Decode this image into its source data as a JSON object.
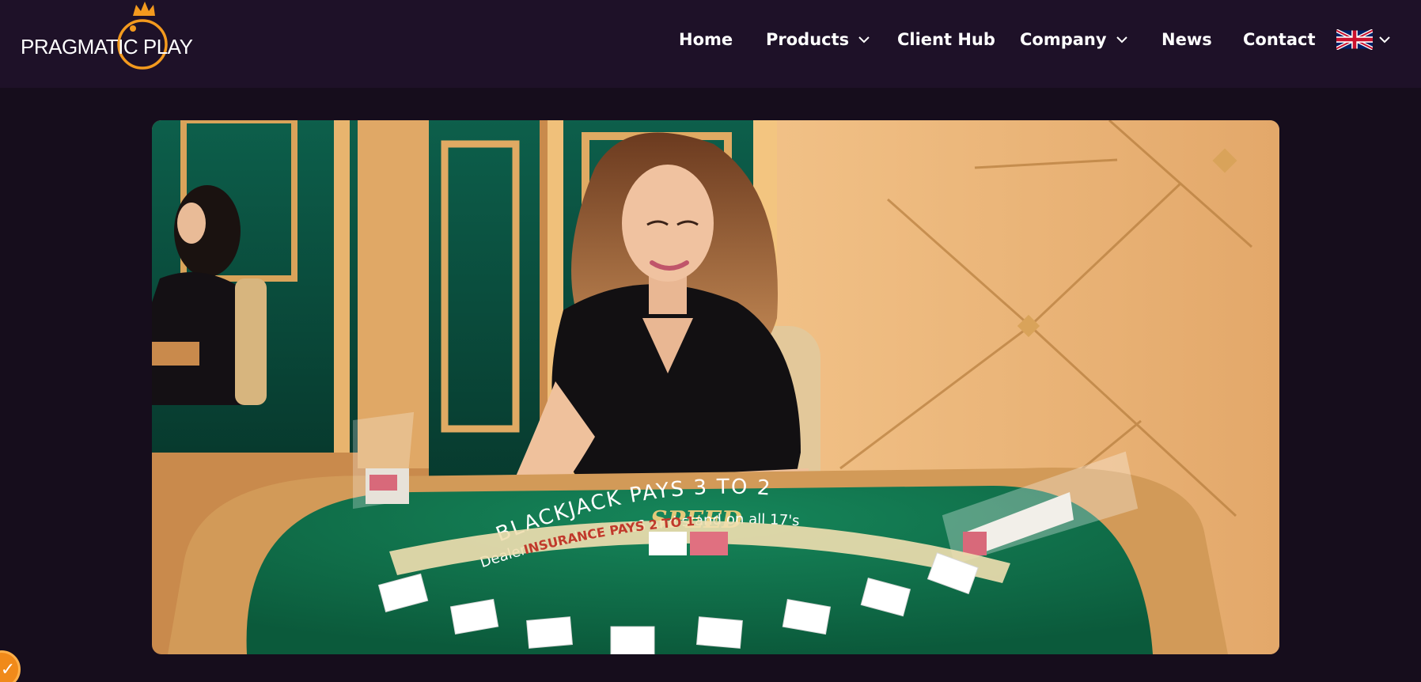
{
  "header": {
    "logo_text": "PRAGMATIC PLAY",
    "nav": [
      {
        "label": "Home",
        "has_dropdown": false
      },
      {
        "label": "Products",
        "has_dropdown": true
      },
      {
        "label": "Client Hub",
        "has_dropdown": false
      },
      {
        "label": "Company",
        "has_dropdown": true
      },
      {
        "label": "News",
        "has_dropdown": false
      },
      {
        "label": "Contact",
        "has_dropdown": false
      }
    ],
    "language_flag_icon": "uk-flag-icon"
  },
  "hero": {
    "image": "live-dealer-speed-blackjack-table",
    "table_title": "SPEED",
    "table_arc_text": "BLACKJACK PAYS 3 TO 2",
    "table_arc_text_2": "Dealer must draw to 16 and stand on all 17's",
    "table_insurance_text": "INSURANCE PAYS 2 TO 1"
  },
  "floating_badge_icon": "pragmatic-badge-icon",
  "colors": {
    "header_bg": "#1e1128",
    "page_bg": "#160d1c",
    "brand_orange": "#f39a1e",
    "felt_green": "#0f6a45"
  }
}
